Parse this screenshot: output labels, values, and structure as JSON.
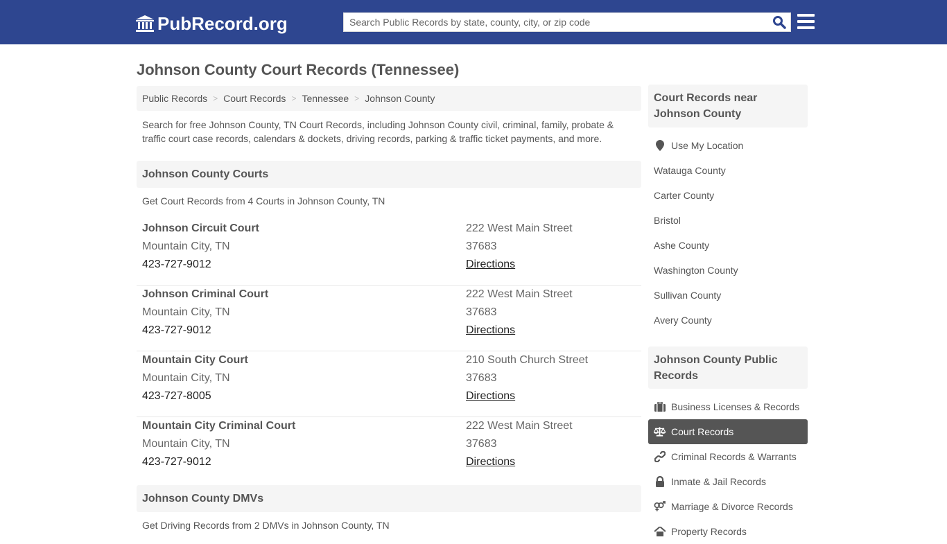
{
  "header": {
    "logo_text": "PubRecord.org",
    "search_placeholder": "Search Public Records by state, county, city, or zip code",
    "brand_color": "#2e4690"
  },
  "page_title": "Johnson County Court Records (Tennessee)",
  "breadcrumb": [
    {
      "label": "Public Records"
    },
    {
      "label": "Court Records"
    },
    {
      "label": "Tennessee"
    },
    {
      "label": "Johnson County"
    }
  ],
  "intro": "Search for free Johnson County, TN Court Records, including Johnson County civil, criminal, family, probate & traffic court case records, calendars & dockets, driving records, parking & traffic ticket payments, and more.",
  "courts_section": {
    "title": "Johnson County Courts",
    "subtitle": "Get Court Records from 4 Courts in Johnson County, TN",
    "courts": [
      {
        "name": "Johnson Circuit Court",
        "city": "Mountain City, TN",
        "phone": "423-727-9012",
        "address": "222 West Main Street",
        "zip": "37683",
        "directions": "Directions"
      },
      {
        "name": "Johnson Criminal Court",
        "city": "Mountain City, TN",
        "phone": "423-727-9012",
        "address": "222 West Main Street",
        "zip": "37683",
        "directions": "Directions"
      },
      {
        "name": "Mountain City Court",
        "city": "Mountain City, TN",
        "phone": "423-727-8005",
        "address": "210 South Church Street",
        "zip": "37683",
        "directions": "Directions"
      },
      {
        "name": "Mountain City Criminal Court",
        "city": "Mountain City, TN",
        "phone": "423-727-9012",
        "address": "222 West Main Street",
        "zip": "37683",
        "directions": "Directions"
      }
    ]
  },
  "dmv_section": {
    "title": "Johnson County DMVs",
    "subtitle": "Get Driving Records from 2 DMVs in Johnson County, TN"
  },
  "sidebar": {
    "nearby": {
      "title": "Court Records near Johnson County",
      "use_location": "Use My Location",
      "items": [
        "Watauga County",
        "Carter County",
        "Bristol",
        "Ashe County",
        "Washington County",
        "Sullivan County",
        "Avery County"
      ]
    },
    "public_records": {
      "title": "Johnson County Public Records",
      "items": [
        {
          "label": "Business Licenses & Records",
          "icon": "briefcase-icon",
          "active": false
        },
        {
          "label": "Court Records",
          "icon": "scale-icon",
          "active": true
        },
        {
          "label": "Criminal Records & Warrants",
          "icon": "link-icon",
          "active": false
        },
        {
          "label": "Inmate & Jail Records",
          "icon": "lock-icon",
          "active": false
        },
        {
          "label": "Marriage & Divorce Records",
          "icon": "gender-icon",
          "active": false
        },
        {
          "label": "Property Records",
          "icon": "home-icon",
          "active": false
        }
      ]
    }
  }
}
